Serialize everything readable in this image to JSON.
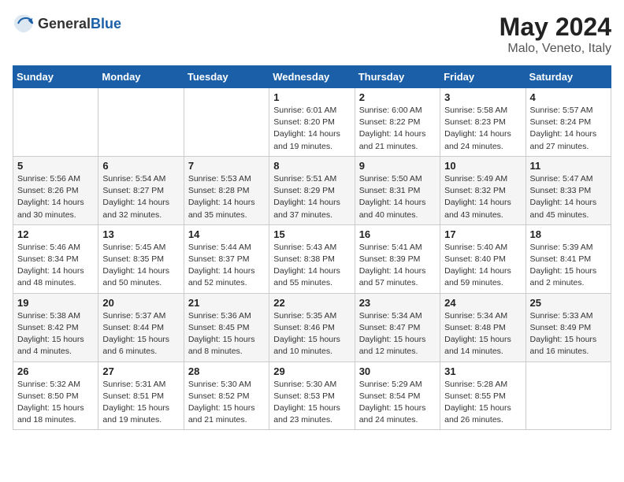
{
  "header": {
    "logo_general": "General",
    "logo_blue": "Blue",
    "month": "May 2024",
    "location": "Malo, Veneto, Italy"
  },
  "days_of_week": [
    "Sunday",
    "Monday",
    "Tuesday",
    "Wednesday",
    "Thursday",
    "Friday",
    "Saturday"
  ],
  "weeks": [
    [
      {
        "day": "",
        "info": ""
      },
      {
        "day": "",
        "info": ""
      },
      {
        "day": "",
        "info": ""
      },
      {
        "day": "1",
        "info": "Sunrise: 6:01 AM\nSunset: 8:20 PM\nDaylight: 14 hours\nand 19 minutes."
      },
      {
        "day": "2",
        "info": "Sunrise: 6:00 AM\nSunset: 8:22 PM\nDaylight: 14 hours\nand 21 minutes."
      },
      {
        "day": "3",
        "info": "Sunrise: 5:58 AM\nSunset: 8:23 PM\nDaylight: 14 hours\nand 24 minutes."
      },
      {
        "day": "4",
        "info": "Sunrise: 5:57 AM\nSunset: 8:24 PM\nDaylight: 14 hours\nand 27 minutes."
      }
    ],
    [
      {
        "day": "5",
        "info": "Sunrise: 5:56 AM\nSunset: 8:26 PM\nDaylight: 14 hours\nand 30 minutes."
      },
      {
        "day": "6",
        "info": "Sunrise: 5:54 AM\nSunset: 8:27 PM\nDaylight: 14 hours\nand 32 minutes."
      },
      {
        "day": "7",
        "info": "Sunrise: 5:53 AM\nSunset: 8:28 PM\nDaylight: 14 hours\nand 35 minutes."
      },
      {
        "day": "8",
        "info": "Sunrise: 5:51 AM\nSunset: 8:29 PM\nDaylight: 14 hours\nand 37 minutes."
      },
      {
        "day": "9",
        "info": "Sunrise: 5:50 AM\nSunset: 8:31 PM\nDaylight: 14 hours\nand 40 minutes."
      },
      {
        "day": "10",
        "info": "Sunrise: 5:49 AM\nSunset: 8:32 PM\nDaylight: 14 hours\nand 43 minutes."
      },
      {
        "day": "11",
        "info": "Sunrise: 5:47 AM\nSunset: 8:33 PM\nDaylight: 14 hours\nand 45 minutes."
      }
    ],
    [
      {
        "day": "12",
        "info": "Sunrise: 5:46 AM\nSunset: 8:34 PM\nDaylight: 14 hours\nand 48 minutes."
      },
      {
        "day": "13",
        "info": "Sunrise: 5:45 AM\nSunset: 8:35 PM\nDaylight: 14 hours\nand 50 minutes."
      },
      {
        "day": "14",
        "info": "Sunrise: 5:44 AM\nSunset: 8:37 PM\nDaylight: 14 hours\nand 52 minutes."
      },
      {
        "day": "15",
        "info": "Sunrise: 5:43 AM\nSunset: 8:38 PM\nDaylight: 14 hours\nand 55 minutes."
      },
      {
        "day": "16",
        "info": "Sunrise: 5:41 AM\nSunset: 8:39 PM\nDaylight: 14 hours\nand 57 minutes."
      },
      {
        "day": "17",
        "info": "Sunrise: 5:40 AM\nSunset: 8:40 PM\nDaylight: 14 hours\nand 59 minutes."
      },
      {
        "day": "18",
        "info": "Sunrise: 5:39 AM\nSunset: 8:41 PM\nDaylight: 15 hours\nand 2 minutes."
      }
    ],
    [
      {
        "day": "19",
        "info": "Sunrise: 5:38 AM\nSunset: 8:42 PM\nDaylight: 15 hours\nand 4 minutes."
      },
      {
        "day": "20",
        "info": "Sunrise: 5:37 AM\nSunset: 8:44 PM\nDaylight: 15 hours\nand 6 minutes."
      },
      {
        "day": "21",
        "info": "Sunrise: 5:36 AM\nSunset: 8:45 PM\nDaylight: 15 hours\nand 8 minutes."
      },
      {
        "day": "22",
        "info": "Sunrise: 5:35 AM\nSunset: 8:46 PM\nDaylight: 15 hours\nand 10 minutes."
      },
      {
        "day": "23",
        "info": "Sunrise: 5:34 AM\nSunset: 8:47 PM\nDaylight: 15 hours\nand 12 minutes."
      },
      {
        "day": "24",
        "info": "Sunrise: 5:34 AM\nSunset: 8:48 PM\nDaylight: 15 hours\nand 14 minutes."
      },
      {
        "day": "25",
        "info": "Sunrise: 5:33 AM\nSunset: 8:49 PM\nDaylight: 15 hours\nand 16 minutes."
      }
    ],
    [
      {
        "day": "26",
        "info": "Sunrise: 5:32 AM\nSunset: 8:50 PM\nDaylight: 15 hours\nand 18 minutes."
      },
      {
        "day": "27",
        "info": "Sunrise: 5:31 AM\nSunset: 8:51 PM\nDaylight: 15 hours\nand 19 minutes."
      },
      {
        "day": "28",
        "info": "Sunrise: 5:30 AM\nSunset: 8:52 PM\nDaylight: 15 hours\nand 21 minutes."
      },
      {
        "day": "29",
        "info": "Sunrise: 5:30 AM\nSunset: 8:53 PM\nDaylight: 15 hours\nand 23 minutes."
      },
      {
        "day": "30",
        "info": "Sunrise: 5:29 AM\nSunset: 8:54 PM\nDaylight: 15 hours\nand 24 minutes."
      },
      {
        "day": "31",
        "info": "Sunrise: 5:28 AM\nSunset: 8:55 PM\nDaylight: 15 hours\nand 26 minutes."
      },
      {
        "day": "",
        "info": ""
      }
    ]
  ]
}
